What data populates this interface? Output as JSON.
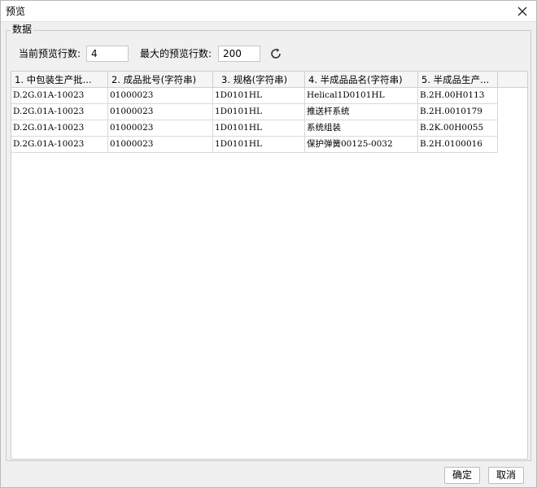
{
  "window": {
    "title": "预览",
    "close_icon": "close-icon"
  },
  "group": {
    "legend": "数据"
  },
  "controls": {
    "current_rows_label": "当前预览行数:",
    "current_rows_value": "4",
    "max_rows_label": "最大的预览行数:",
    "max_rows_value": "200",
    "refresh_icon": "refresh-icon"
  },
  "table": {
    "headers": [
      "1. 中包装生产批...",
      "2. 成品批号(字符串)",
      "3. 规格(字符串)",
      "4. 半成品品名(字符串)",
      "5. 半成品生产..."
    ],
    "rows": [
      [
        "D.2G.01A-10023",
        "01000023",
        "1D0101HL",
        "Helical1D0101HL",
        "B.2H.00H0113"
      ],
      [
        "D.2G.01A-10023",
        "01000023",
        "1D0101HL",
        "推送杆系统",
        "B.2H.0010179"
      ],
      [
        "D.2G.01A-10023",
        "01000023",
        "1D0101HL",
        "系统组装",
        "B.2K.00H0055"
      ],
      [
        "D.2G.01A-10023",
        "01000023",
        "1D0101HL",
        "保护弹簧00125-0032",
        "B.2H.0100016"
      ]
    ]
  },
  "footer": {
    "ok_label": "确定",
    "cancel_label": "取消"
  }
}
